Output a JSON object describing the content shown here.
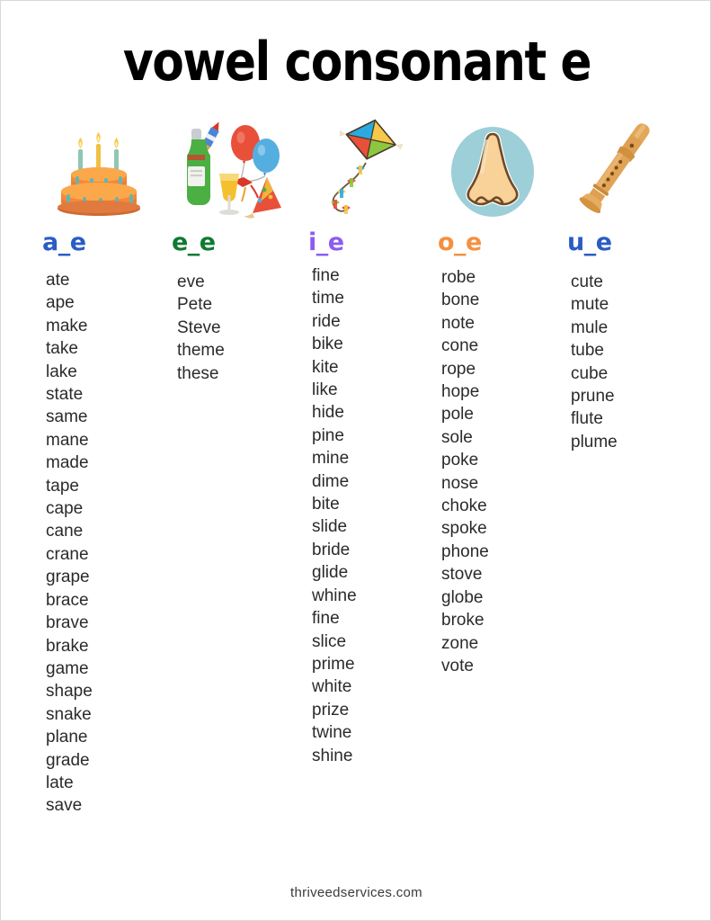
{
  "page": {
    "title": "vowel consonant e",
    "footer": "thriveedservices.com",
    "background": "#ffffff",
    "text_color": "#2b2b2b"
  },
  "columns": [
    {
      "id": "a_e",
      "header": "a_e",
      "header_color": "#2a5cc4",
      "illustration": "birthday-cake",
      "words": [
        "ate",
        "ape",
        "make",
        "take",
        "lake",
        "state",
        "same",
        "mane",
        "made",
        "tape",
        "cape",
        "cane",
        "crane",
        "grape",
        "brace",
        "brave",
        "brake",
        "game",
        "shape",
        "snake",
        "plane",
        "grade",
        "late",
        "save"
      ]
    },
    {
      "id": "e_e",
      "header": "e_e",
      "header_color": "#0f7a30",
      "illustration": "celebration-party",
      "words": [
        "eve",
        "Pete",
        "Steve",
        "theme",
        "these"
      ]
    },
    {
      "id": "i_e",
      "header": "i_e",
      "header_color": "#8b5cf0",
      "illustration": "kite",
      "words": [
        "fine",
        "time",
        "ride",
        "bike",
        "kite",
        "like",
        "hide",
        "pine",
        "mine",
        "dime",
        "bite",
        "slide",
        "bride",
        "glide",
        "whine",
        "fine",
        "slice",
        "prime",
        "white",
        "prize",
        "twine",
        "shine"
      ]
    },
    {
      "id": "o_e",
      "header": "o_e",
      "header_color": "#f59040",
      "illustration": "nose",
      "words": [
        "robe",
        "bone",
        "note",
        "cone",
        "rope",
        "hope",
        "pole",
        "sole",
        "poke",
        "nose",
        "choke",
        "spoke",
        "phone",
        "stove",
        "globe",
        "broke",
        "zone",
        "vote"
      ]
    },
    {
      "id": "u_e",
      "header": "u_e",
      "header_color": "#2a5cc4",
      "illustration": "flute-recorder",
      "words": [
        "cute",
        "mute",
        "mule",
        "tube",
        "cube",
        "prune",
        "flute",
        "plume"
      ]
    }
  ]
}
